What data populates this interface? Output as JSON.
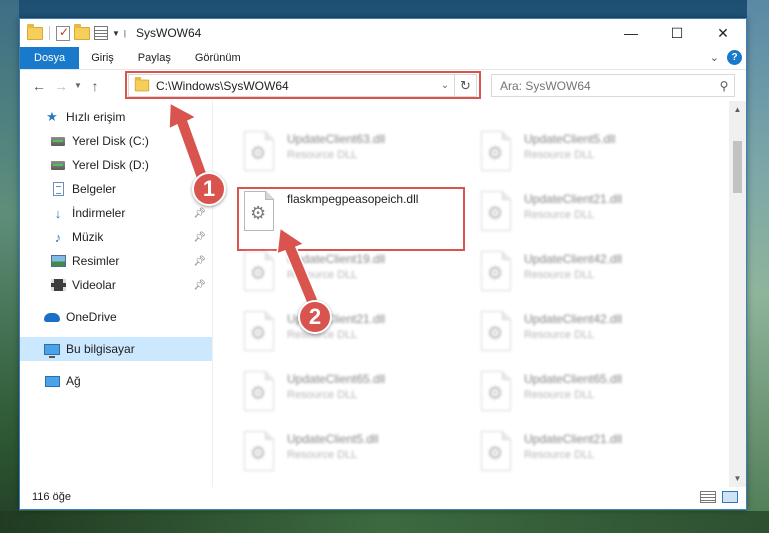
{
  "window": {
    "title": "SysWOW64",
    "minimize": "—",
    "maximize": "☐",
    "close": "✕"
  },
  "ribbon": {
    "tabs": [
      "Dosya",
      "Giriş",
      "Paylaş",
      "Görünüm"
    ],
    "active_tab": "Dosya",
    "help": "?"
  },
  "nav": {
    "address": "C:\\Windows\\SysWOW64",
    "search_placeholder": "Ara: SysWOW64"
  },
  "sidebar": {
    "items": [
      {
        "label": "Hızlı erişim",
        "icon": "star-icon"
      },
      {
        "label": "Yerel Disk (C:)",
        "icon": "drive-icon"
      },
      {
        "label": "Yerel Disk (D:)",
        "icon": "drive-icon"
      },
      {
        "label": "Belgeler",
        "icon": "documents-icon"
      },
      {
        "label": "İndirmeler",
        "icon": "downloads-icon"
      },
      {
        "label": "Müzik",
        "icon": "music-icon"
      },
      {
        "label": "Resimler",
        "icon": "pictures-icon"
      },
      {
        "label": "Videolar",
        "icon": "videos-icon"
      },
      {
        "label": "OneDrive",
        "icon": "onedrive-icon"
      },
      {
        "label": "Bu bilgisayar",
        "icon": "this-pc-icon"
      },
      {
        "label": "Ağ",
        "icon": "network-icon"
      }
    ]
  },
  "files": [
    {
      "name": "UpdateClient63.dll",
      "type": "Resource DLL"
    },
    {
      "name": "UpdateClient5.dll",
      "type": "Resource DLL"
    },
    {
      "name": "flaskmpegpeasopeich.dll",
      "type": ""
    },
    {
      "name": "UpdateClient21.dll",
      "type": "Resource DLL"
    },
    {
      "name": "UpdateClient19.dll",
      "type": "Resource DLL"
    },
    {
      "name": "UpdateClient42.dll",
      "type": "Resource DLL"
    },
    {
      "name": "UpdateClient21.dll",
      "type": "Resource DLL"
    },
    {
      "name": "UpdateClient42.dll",
      "type": "Resource DLL"
    },
    {
      "name": "UpdateClient65.dll",
      "type": "Resource DLL"
    },
    {
      "name": "UpdateClient65.dll",
      "type": "Resource DLL"
    },
    {
      "name": "UpdateClient5.dll",
      "type": "Resource DLL"
    },
    {
      "name": "UpdateClient21.dll",
      "type": "Resource DLL"
    }
  ],
  "status": {
    "item_count": "116 öğe"
  },
  "markers": [
    "1",
    "2"
  ],
  "colors": {
    "accent": "#1979ca",
    "highlight": "#d9534f",
    "selected": "#cce8ff"
  }
}
